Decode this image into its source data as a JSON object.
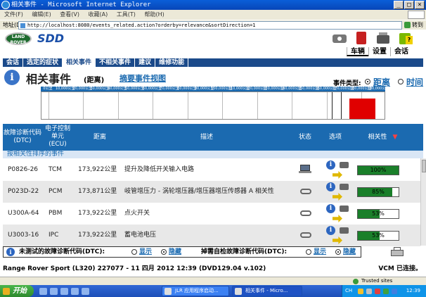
{
  "window": {
    "title": "相关事件 - Microsoft Internet Explorer",
    "buttons": {
      "minimize": "_",
      "maximize": "□",
      "close": "×"
    }
  },
  "menu": [
    "文件(F)",
    "编辑(E)",
    "查看(V)",
    "收藏(A)",
    "工具(T)",
    "帮助(H)"
  ],
  "address": {
    "label": "地址(D)",
    "url": "http://localhost:8080/events_related.action?orderby=relevance&sortDirection=1",
    "go": "转到"
  },
  "header": {
    "logo_text": "LAND ROVER",
    "app_name": "SDD",
    "tabs": [
      {
        "label": "车辆",
        "active": true
      },
      {
        "label": "设置",
        "active": false
      },
      {
        "label": "会话",
        "active": false
      }
    ]
  },
  "nav": {
    "items": [
      {
        "label": "会话",
        "active": false
      },
      {
        "label": "选定的症状",
        "active": false
      },
      {
        "label": "相关事件",
        "active": true
      },
      {
        "label": "不相关事件",
        "active": false
      },
      {
        "label": "建议",
        "active": false
      },
      {
        "label": "维修功能",
        "active": false
      }
    ]
  },
  "title": {
    "main": "相关事件",
    "sub": "(距离)",
    "summary_link": "摘要事件视图",
    "event_type_label": "事件类型:",
    "event_type_options": [
      {
        "label": "距离",
        "selected": true
      },
      {
        "label": "时间",
        "selected": false
      }
    ]
  },
  "chart_data": {
    "type": "table",
    "title": "",
    "axis_ticks": [
      "0公里",
      "10,000公里",
      "20,000公里",
      "30,000公里",
      "40,000公里",
      "50,000公里",
      "60,000公里",
      "70,000公里",
      "80,000公里",
      "90,000公里",
      "100,000公里",
      "110,000公里",
      "120,000公里",
      "130,000公里",
      "140,000公里",
      "150,000公里",
      "160,000公里",
      "170,000公里",
      "180,000公里",
      "190,000公里"
    ],
    "xlim": [
      0,
      190000
    ],
    "highlight_range_km": [
      173000,
      188000
    ],
    "markers_km": [
      163000,
      168000
    ]
  },
  "table": {
    "headers": {
      "dtc": "故障诊断代码(DTC)",
      "ecu": "电子控制单元(ECU)",
      "distance": "距离",
      "description": "描述",
      "status": "状态",
      "options": "选项",
      "relevance": "相关性"
    },
    "sort_indicator": "▼",
    "group_label": "按相关性排序的事件",
    "rows": [
      {
        "dtc": "P0826-26",
        "ecu": "TCM",
        "distance": "173,922公里",
        "description": "提升及降低开关输入电路",
        "status_icon": "laptop-icon",
        "relevance": 100,
        "relevance_label": "100%"
      },
      {
        "dtc": "P023D-22",
        "ecu": "PCM",
        "distance": "173,871公里",
        "description": "岐管增压力 - 涡轮增压器/增压器增压传感器 A 相关性",
        "status_icon": "link-icon",
        "relevance": 85,
        "relevance_label": "85%"
      },
      {
        "dtc": "U300A-64",
        "ecu": "PBM",
        "distance": "173,922公里",
        "description": "点火开关",
        "status_icon": "link-icon",
        "relevance": 53,
        "relevance_label": "53%"
      },
      {
        "dtc": "U3003-16",
        "ecu": "IPC",
        "distance": "173,922公里",
        "description": "蓄电池电压",
        "status_icon": "link-icon",
        "relevance": 53,
        "relevance_label": "53%"
      }
    ]
  },
  "bottom": {
    "untested_label": "未测试的故障诊断代码(DTC):",
    "selftest_label": "掉需自检故障诊断代码(DTC):",
    "show": "显示",
    "hide": "隐藏"
  },
  "footer": {
    "vehicle": "Range Rover Sport (L320) 227077 - 11 四月  2012 12:39 (DVD129.04 v.102)",
    "vcm": "VCM 已连接。"
  },
  "statusbar": {
    "trusted": "Trusted sites"
  },
  "taskbar": {
    "start": "开始",
    "tasks": [
      {
        "label": "JLR 应用程序启动...",
        "active": false
      },
      {
        "label": "相关事件 - Micro...",
        "active": true
      }
    ],
    "lang": "CH",
    "clock": "12:39"
  }
}
